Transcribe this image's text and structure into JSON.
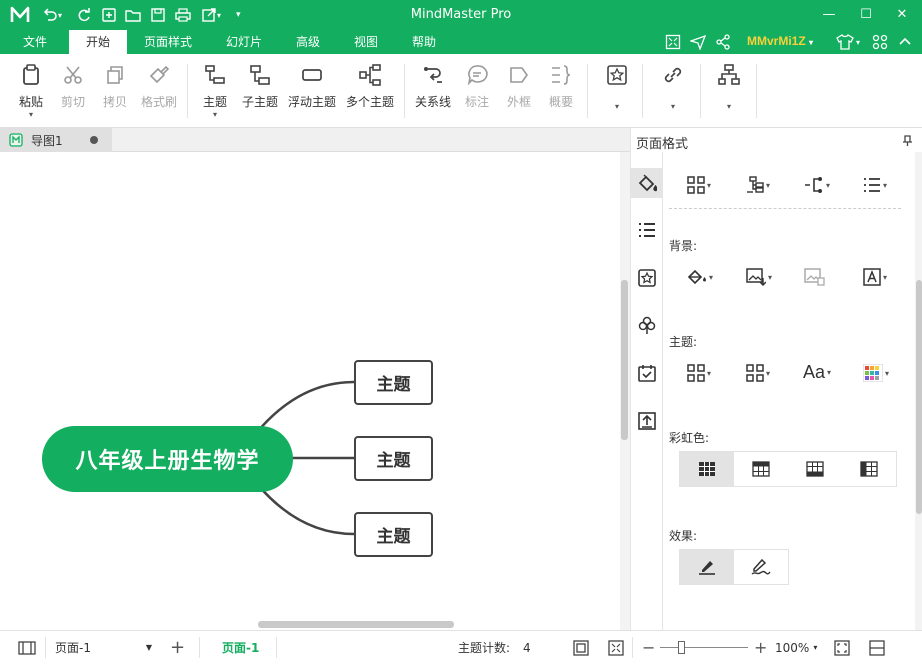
{
  "app": {
    "title": "MindMaster Pro",
    "user": "MMvrMi1Z"
  },
  "menu": {
    "tabs": [
      "文件",
      "开始",
      "页面样式",
      "幻灯片",
      "高级",
      "视图",
      "帮助"
    ],
    "active": "开始"
  },
  "ribbon": {
    "paste": "粘贴",
    "cut": "剪切",
    "copy": "拷贝",
    "format_painter": "格式刷",
    "topic": "主题",
    "subtopic": "子主题",
    "floating_topic": "浮动主题",
    "multi_topic": "多个主题",
    "relationship": "关系线",
    "callout": "标注",
    "boundary": "外框",
    "summary": "概要"
  },
  "doc": {
    "tab_name": "导图1"
  },
  "mindmap": {
    "root": "八年级上册生物学",
    "children": [
      "主题",
      "主题",
      "主题"
    ]
  },
  "panel": {
    "title": "页面格式",
    "background_label": "背景:",
    "theme_label": "主题:",
    "rainbow_label": "彩虹色:",
    "effect_label": "效果:"
  },
  "status": {
    "page_select": "页面-1",
    "page_tab": "页面-1",
    "topic_count_label": "主题计数:",
    "topic_count": "4",
    "zoom": "100%"
  },
  "colors": {
    "brand": "#13ae5f",
    "user": "#f7d23a"
  }
}
